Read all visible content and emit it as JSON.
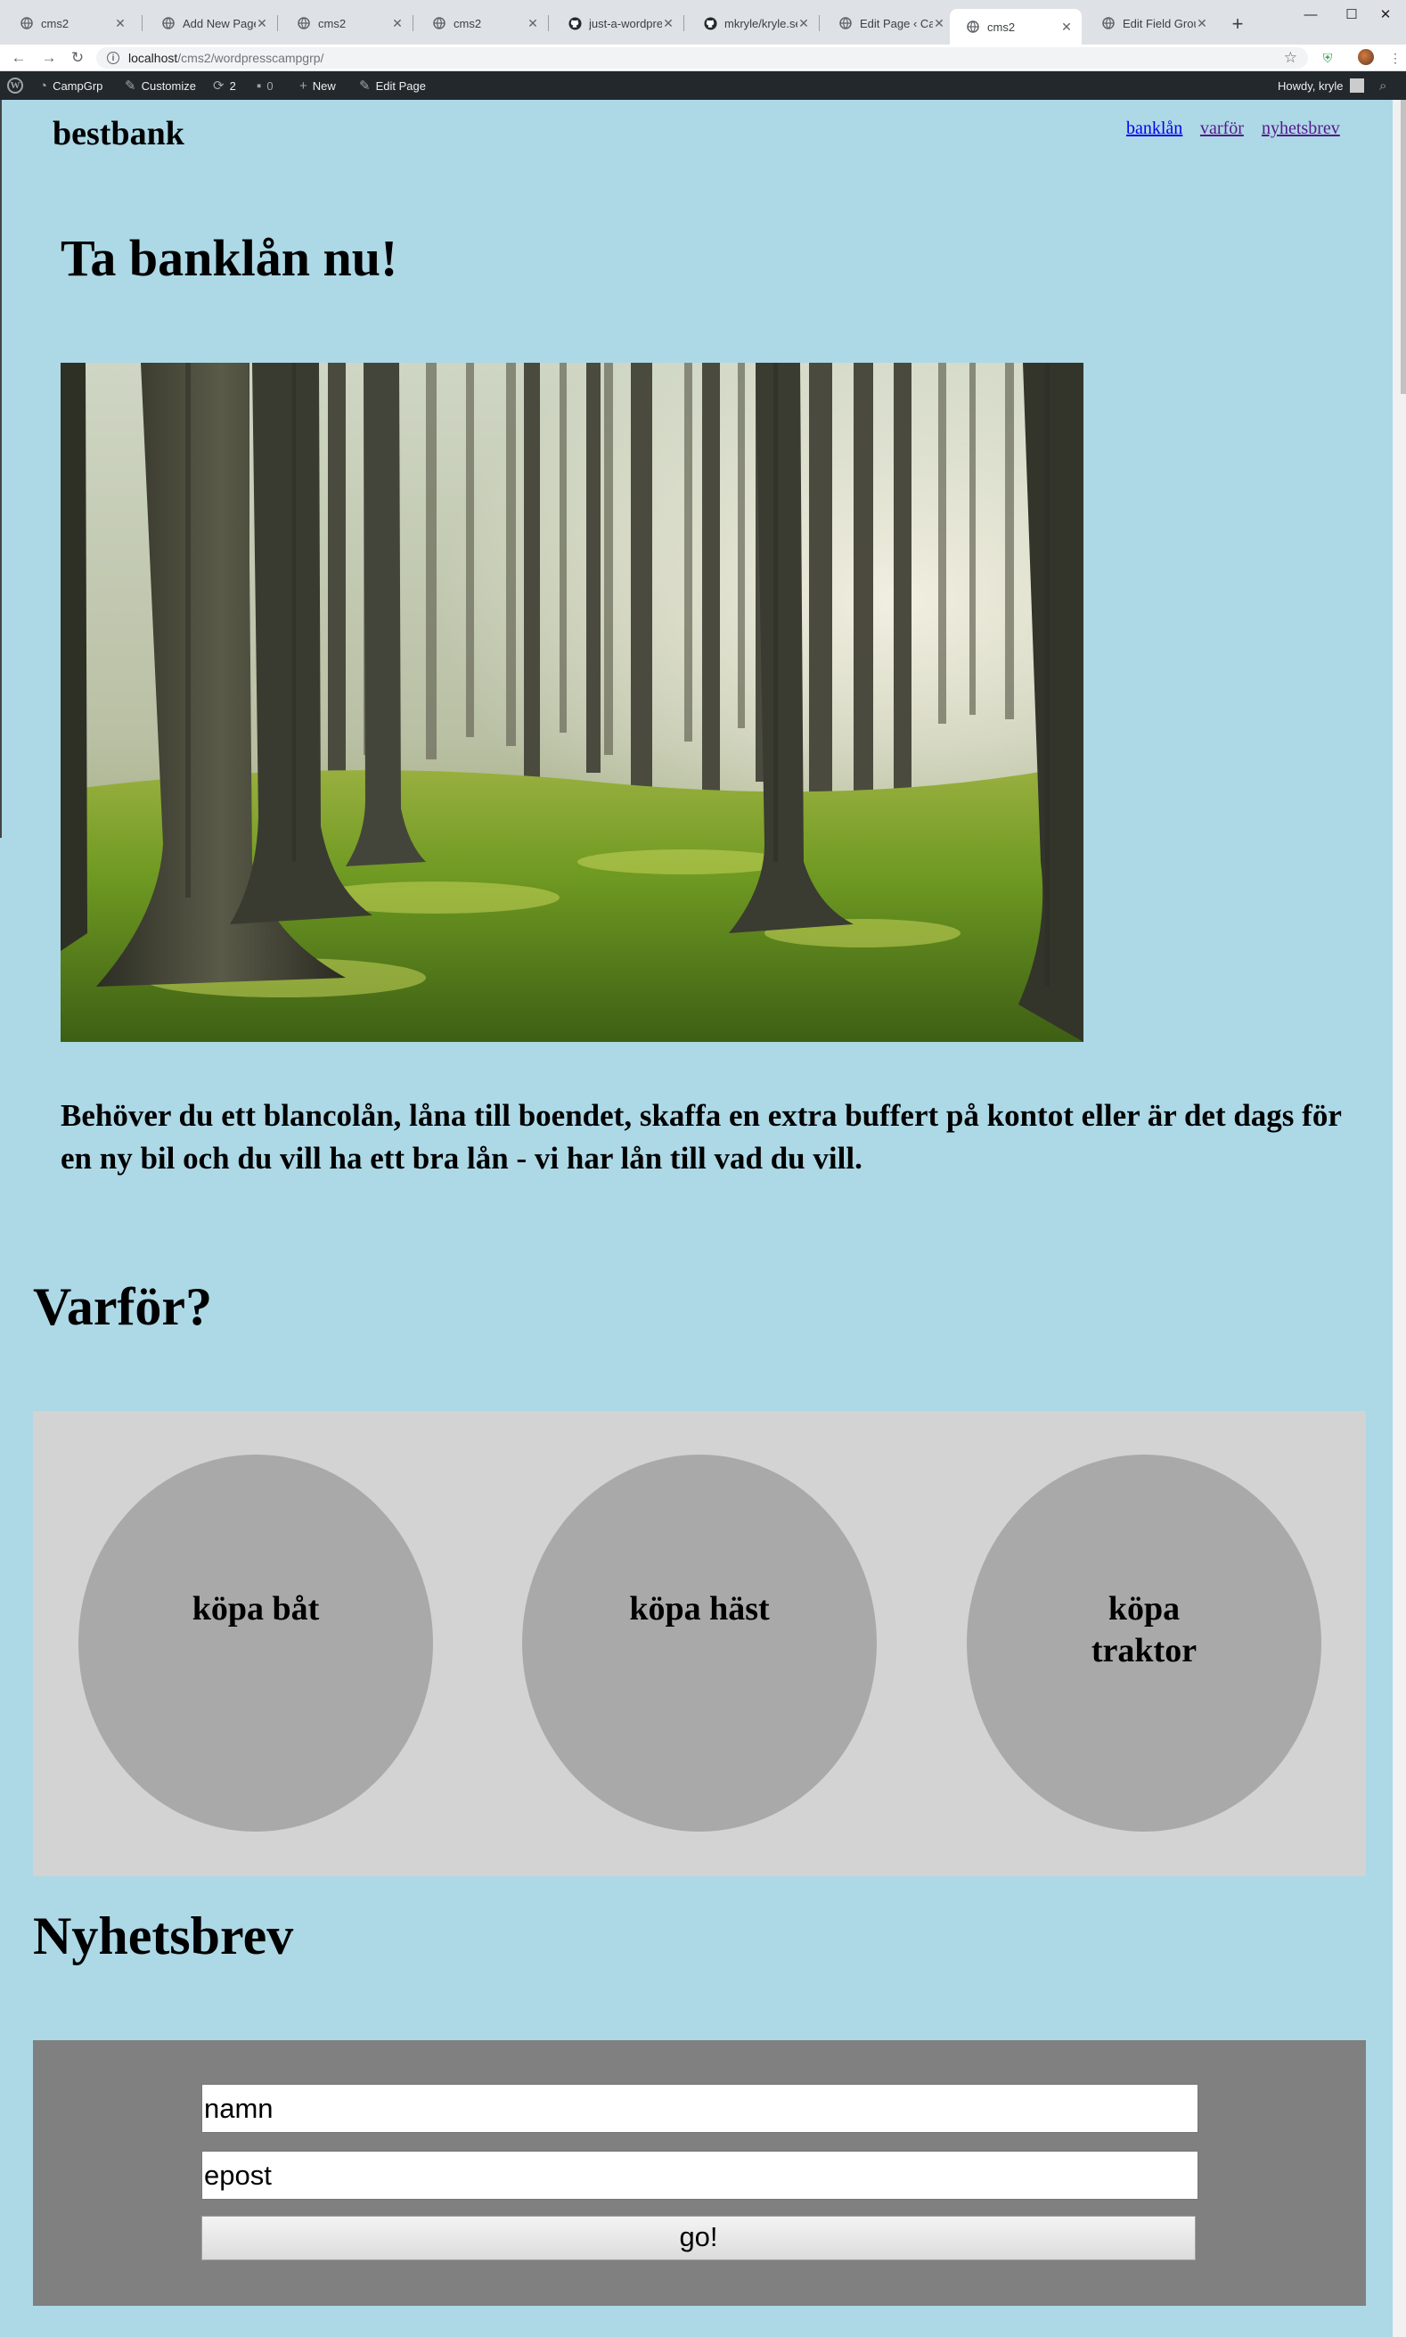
{
  "browser": {
    "tabs": [
      {
        "title": "cms2",
        "icon": "globe-icon"
      },
      {
        "title": "Add New Page",
        "icon": "globe-icon"
      },
      {
        "title": "cms2",
        "icon": "globe-icon"
      },
      {
        "title": "cms2",
        "icon": "globe-icon"
      },
      {
        "title": "just-a-wordpres",
        "icon": "github-icon"
      },
      {
        "title": "mkryle/kryle.se",
        "icon": "github-icon"
      },
      {
        "title": "Edit Page ‹ Cam",
        "icon": "globe-icon"
      },
      {
        "title": "cms2",
        "icon": "globe-icon",
        "active": true
      },
      {
        "title": "Edit Field Group",
        "icon": "globe-icon"
      }
    ],
    "url_host": "localhost",
    "url_path": "/cms2/wordpresscampgrp/"
  },
  "wp_admin_bar": {
    "site_name": "CampGrp",
    "customize": "Customize",
    "updates_count": "2",
    "comments_count": "0",
    "new": "New",
    "edit_page": "Edit Page",
    "howdy": "Howdy, kryle"
  },
  "site": {
    "title": "bestbank",
    "nav": [
      "banklån",
      "varför",
      "nyhetsbrev"
    ]
  },
  "hero": {
    "title": "Ta banklån nu!",
    "text": "Behöver du ett blancolån, låna till boendet, skaffa en extra buffert på kontot eller är det dags för en ny bil och du vill ha ett bra lån - vi har lån till vad du vill."
  },
  "reasons": {
    "title": "Varför?",
    "items": [
      "köpa båt",
      "köpa häst",
      "köpa traktor"
    ]
  },
  "newsletter": {
    "title": "Nyhetsbrev",
    "name_placeholder": "namn",
    "email_placeholder": "epost",
    "submit_label": "go!"
  },
  "colors": {
    "page_bg": "#add8e6",
    "reasons_bg": "#d3d3d3",
    "circle_bg": "#a9a9a9",
    "newsletter_bg": "#808080"
  }
}
